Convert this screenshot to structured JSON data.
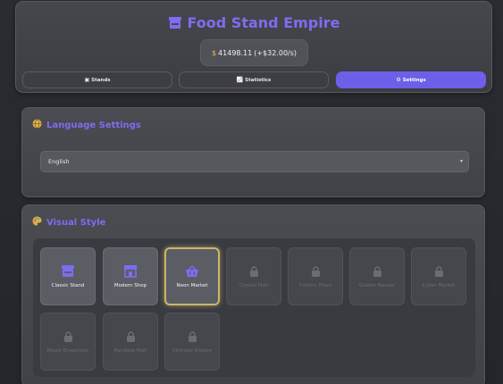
{
  "header": {
    "title": "Food Stand Empire",
    "money": "41498.11",
    "rate": "(+$32.00/s)",
    "money_prefix": "$"
  },
  "tabs": [
    {
      "label": "Stands",
      "icon": "shop-icon",
      "active": false
    },
    {
      "label": "Statistics",
      "icon": "chart-icon",
      "active": false
    },
    {
      "label": "Settings",
      "icon": "gear-icon",
      "active": true
    }
  ],
  "language": {
    "title": "Language Settings",
    "icon": "globe-icon",
    "selected": "English"
  },
  "visual": {
    "title": "Visual Style",
    "icon": "palette-icon",
    "styles": [
      {
        "label": "Classic Stand",
        "locked": false,
        "selected": false,
        "icon": "shop-icon"
      },
      {
        "label": "Modern Shop",
        "locked": false,
        "selected": false,
        "icon": "store-icon"
      },
      {
        "label": "Neon Market",
        "locked": false,
        "selected": true,
        "icon": "basket-icon"
      },
      {
        "label": "Crystal Mall",
        "locked": true
      },
      {
        "label": "Cosmic Plaza",
        "locked": true
      },
      {
        "label": "Golden Bazaar",
        "locked": true
      },
      {
        "label": "Cyber Market",
        "locked": true
      },
      {
        "label": "Magic Emporium",
        "locked": true
      },
      {
        "label": "Rainbow Mall",
        "locked": true
      },
      {
        "label": "Ultimate Empire",
        "locked": true
      }
    ]
  },
  "colors": {
    "accent": "#6e5fe8",
    "title": "#7d6df0",
    "selected_border": "#c9b56c"
  }
}
